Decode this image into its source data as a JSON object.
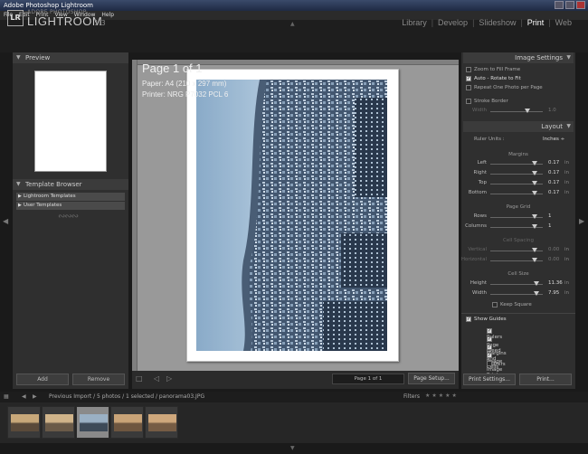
{
  "window": {
    "title": "Adobe Photoshop Lightroom"
  },
  "menu": [
    "File",
    "Edit",
    "Print",
    "View",
    "Window",
    "Help"
  ],
  "identity": {
    "badge": "LR",
    "adobe": "ADOBE PHOTOSHOP",
    "product": "LIGHTROOM",
    "version": "1.3"
  },
  "modules": [
    {
      "label": "Library",
      "active": false
    },
    {
      "label": "Develop",
      "active": false
    },
    {
      "label": "Slideshow",
      "active": false
    },
    {
      "label": "Print",
      "active": true
    },
    {
      "label": "Web",
      "active": false
    }
  ],
  "left_panel": {
    "preview_title": "Preview",
    "template_browser_title": "Template Browser",
    "templates": [
      "Lightroom Templates",
      "User Templates"
    ],
    "add_label": "Add",
    "remove_label": "Remove"
  },
  "center": {
    "page_title": "Page 1 of 1",
    "paper": "Paper:  A4 (210 x 297 mm)",
    "printer": "Printer:  NRG P7032 PCL 6",
    "page_counter": "Page 1 of 1",
    "page_setup_label": "Page Setup..."
  },
  "image_settings": {
    "title": "Image Settings",
    "options": [
      {
        "label": "Zoom to Fill Frame",
        "checked": false
      },
      {
        "label": "Auto - Rotate to Fit",
        "checked": true
      },
      {
        "label": "Repeat One Photo per Page",
        "checked": false
      },
      {
        "label": "Stroke Border",
        "checked": false
      }
    ],
    "width_label": "Width",
    "width_value": "1.0"
  },
  "layout": {
    "title": "Layout",
    "ruler_units_label": "Ruler Units :",
    "ruler_units_value": "Inches ÷",
    "margins_title": "Margins",
    "margins": [
      {
        "label": "Left",
        "value": "0.17",
        "pos": 0.85
      },
      {
        "label": "Right",
        "value": "0.17",
        "pos": 0.85
      },
      {
        "label": "Top",
        "value": "0.17",
        "pos": 0.85
      },
      {
        "label": "Bottom",
        "value": "0.17",
        "pos": 0.85
      }
    ],
    "page_grid_title": "Page Grid",
    "grid": [
      {
        "label": "Rows",
        "value": "1",
        "pos": 0.85
      },
      {
        "label": "Columns",
        "value": "1",
        "pos": 0.85
      }
    ],
    "cell_spacing_title": "Cell Spacing",
    "spacing": [
      {
        "label": "Vertical",
        "value": "0.00",
        "pos": 0.85
      },
      {
        "label": "Horizontal",
        "value": "0.00",
        "pos": 0.85
      }
    ],
    "cell_size_title": "Cell Size",
    "size": [
      {
        "label": "Height",
        "value": "11.36",
        "pos": 0.88
      },
      {
        "label": "Width",
        "value": "7.95",
        "pos": 0.88
      }
    ],
    "keep_square_label": "Keep Square",
    "unit": "in"
  },
  "guides": {
    "show_label": "Show Guides",
    "items": [
      {
        "label": "Rulers",
        "checked": true
      },
      {
        "label": "Page Bleed",
        "checked": true
      },
      {
        "label": "Margins and Gutters",
        "checked": true
      },
      {
        "label": "Image Cells",
        "checked": true
      },
      {
        "label": "Image Print Sizes",
        "checked": false
      }
    ]
  },
  "right_buttons": {
    "print_settings": "Print Settings...",
    "print": "Print..."
  },
  "filmstrip": {
    "source": "Previous Import / 5 photos / 1 selected / panorama03.JPG",
    "filters_label": "Filters",
    "thumbs": [
      {
        "selected": false,
        "sky": "#c8a87a",
        "ground": "#5a4a3a"
      },
      {
        "selected": false,
        "sky": "#d0b48a",
        "ground": "#6a5a48"
      },
      {
        "selected": true,
        "sky": "#9ab0c4",
        "ground": "#3d4a58"
      },
      {
        "selected": false,
        "sky": "#c9a478",
        "ground": "#6e5640"
      },
      {
        "selected": false,
        "sky": "#cfa87c",
        "ground": "#765c44"
      }
    ]
  }
}
